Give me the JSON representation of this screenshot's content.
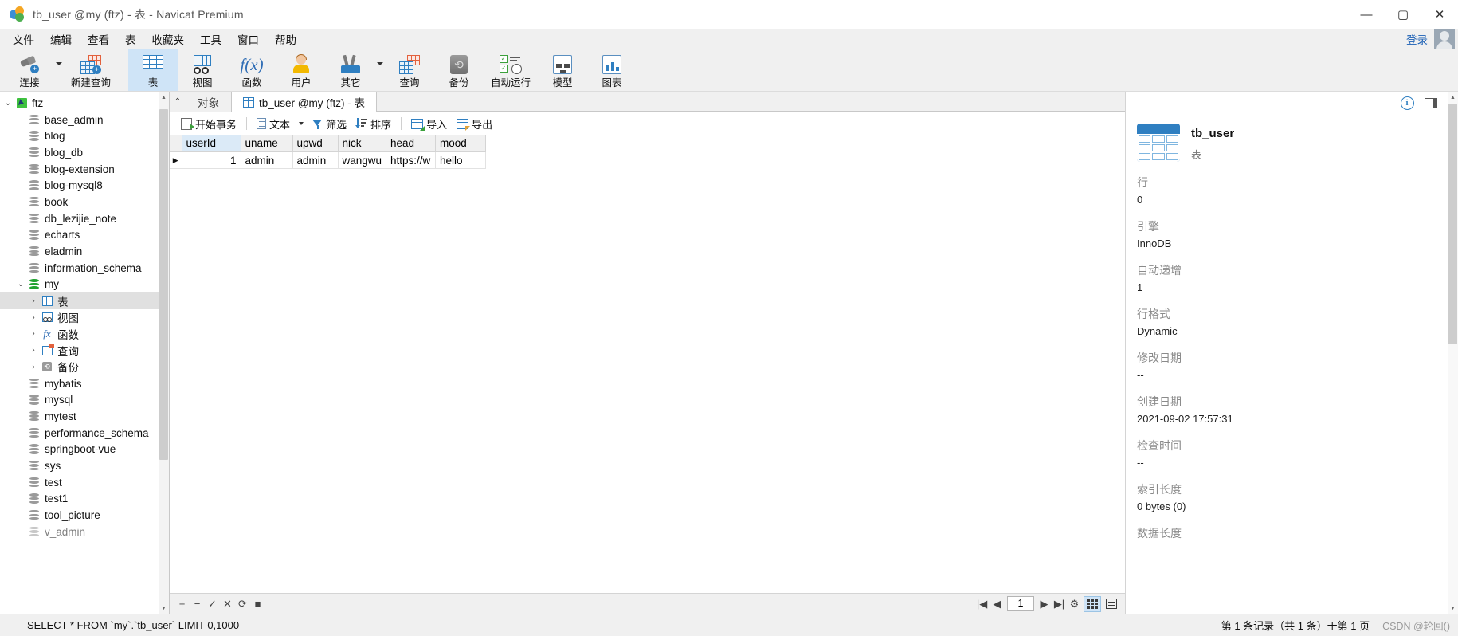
{
  "window": {
    "title": "tb_user @my (ftz) - 表 - Navicat Premium",
    "logo": "navicat-logo",
    "minimize": "—",
    "maximize": "▢",
    "close": "✕"
  },
  "menubar": {
    "items": [
      "文件",
      "编辑",
      "查看",
      "表",
      "收藏夹",
      "工具",
      "窗口",
      "帮助"
    ],
    "login_label": "登录"
  },
  "ribbon": {
    "items": [
      {
        "label": "连接",
        "icon": "connection-icon",
        "has_caret": true,
        "selected": false
      },
      {
        "label": "新建查询",
        "icon": "new-query-icon",
        "has_caret": false,
        "selected": false
      },
      {
        "label": "表",
        "icon": "table-icon",
        "has_caret": false,
        "selected": true
      },
      {
        "label": "视图",
        "icon": "view-icon",
        "has_caret": false,
        "selected": false
      },
      {
        "label": "函数",
        "icon": "function-icon",
        "has_caret": false,
        "selected": false
      },
      {
        "label": "用户",
        "icon": "user-icon",
        "has_caret": false,
        "selected": false
      },
      {
        "label": "其它",
        "icon": "other-tools-icon",
        "has_caret": true,
        "selected": false
      },
      {
        "label": "查询",
        "icon": "query-icon",
        "has_caret": false,
        "selected": false
      },
      {
        "label": "备份",
        "icon": "backup-icon",
        "has_caret": false,
        "selected": false
      },
      {
        "label": "自动运行",
        "icon": "automation-icon",
        "has_caret": false,
        "selected": false
      },
      {
        "label": "模型",
        "icon": "model-icon",
        "has_caret": false,
        "selected": false
      },
      {
        "label": "图表",
        "icon": "chart-icon",
        "has_caret": false,
        "selected": false
      }
    ]
  },
  "sidebar": {
    "nodes": [
      {
        "label": "ftz",
        "icon": "connection-node-icon",
        "level": 0,
        "expanded": true,
        "selected": false
      },
      {
        "label": "base_admin",
        "icon": "database-icon",
        "level": 1,
        "selected": false
      },
      {
        "label": "blog",
        "icon": "database-icon",
        "level": 1,
        "selected": false
      },
      {
        "label": "blog_db",
        "icon": "database-icon",
        "level": 1,
        "selected": false
      },
      {
        "label": "blog-extension",
        "icon": "database-icon",
        "level": 1,
        "selected": false
      },
      {
        "label": "blog-mysql8",
        "icon": "database-icon",
        "level": 1,
        "selected": false
      },
      {
        "label": "book",
        "icon": "database-icon",
        "level": 1,
        "selected": false
      },
      {
        "label": "db_lezijie_note",
        "icon": "database-icon",
        "level": 1,
        "selected": false
      },
      {
        "label": "echarts",
        "icon": "database-icon",
        "level": 1,
        "selected": false
      },
      {
        "label": "eladmin",
        "icon": "database-icon",
        "level": 1,
        "selected": false
      },
      {
        "label": "information_schema",
        "icon": "database-icon",
        "level": 1,
        "selected": false
      },
      {
        "label": "my",
        "icon": "database-open-icon",
        "level": 1,
        "expanded": true,
        "selected": false
      },
      {
        "label": "表",
        "icon": "tables-folder-icon",
        "level": 2,
        "collapsed": true,
        "selected": true
      },
      {
        "label": "视图",
        "icon": "views-folder-icon",
        "level": 2,
        "collapsed": true,
        "selected": false
      },
      {
        "label": "函数",
        "icon": "functions-folder-icon",
        "level": 2,
        "collapsed": true,
        "selected": false
      },
      {
        "label": "查询",
        "icon": "queries-folder-icon",
        "level": 2,
        "collapsed": true,
        "selected": false
      },
      {
        "label": "备份",
        "icon": "backups-folder-icon",
        "level": 2,
        "collapsed": true,
        "selected": false
      },
      {
        "label": "mybatis",
        "icon": "database-icon",
        "level": 1,
        "selected": false
      },
      {
        "label": "mysql",
        "icon": "database-icon",
        "level": 1,
        "selected": false
      },
      {
        "label": "mytest",
        "icon": "database-icon",
        "level": 1,
        "selected": false
      },
      {
        "label": "performance_schema",
        "icon": "database-icon",
        "level": 1,
        "selected": false
      },
      {
        "label": "springboot-vue",
        "icon": "database-icon",
        "level": 1,
        "selected": false
      },
      {
        "label": "sys",
        "icon": "database-icon",
        "level": 1,
        "selected": false
      },
      {
        "label": "test",
        "icon": "database-icon",
        "level": 1,
        "selected": false
      },
      {
        "label": "test1",
        "icon": "database-icon",
        "level": 1,
        "selected": false
      },
      {
        "label": "tool_picture",
        "icon": "database-icon",
        "level": 1,
        "selected": false
      },
      {
        "label": "v_admin",
        "icon": "database-icon",
        "level": 1,
        "selected": false
      }
    ]
  },
  "tabs": {
    "collapse_icon": "chevron-up-icon",
    "items": [
      {
        "label": "对象",
        "active": false,
        "icon": null
      },
      {
        "label": "tb_user @my (ftz) - 表",
        "active": true,
        "icon": "table-tab-icon"
      }
    ]
  },
  "grid_toolbar": {
    "buttons": [
      {
        "label": "开始事务",
        "icon": "begin-transaction-icon",
        "caret": false
      },
      {
        "label": "文本",
        "icon": "text-icon",
        "caret": true
      },
      {
        "label": "筛选",
        "icon": "filter-icon",
        "caret": false
      },
      {
        "label": "排序",
        "icon": "sort-icon",
        "caret": false
      },
      {
        "label": "导入",
        "icon": "import-icon",
        "caret": false
      },
      {
        "label": "导出",
        "icon": "export-icon",
        "caret": false
      }
    ]
  },
  "datagrid": {
    "columns": [
      "userId",
      "uname",
      "upwd",
      "nick",
      "head",
      "mood"
    ],
    "key_column": "userId",
    "rows": [
      {
        "current": true,
        "cells": [
          "1",
          "admin",
          "admin",
          "wangwu",
          "https://w",
          "hello"
        ]
      }
    ]
  },
  "grid_footer": {
    "add_label": "+",
    "remove_label": "−",
    "confirm_label": "✓",
    "cancel_label": "✕",
    "refresh_label": "⟳",
    "stop_label": "■",
    "first_label": "|◀",
    "prev_label": "◀",
    "page_value": "1",
    "next_label": "▶",
    "last_label": "▶|",
    "settings_label": "gear-icon",
    "grid_view_label": "grid-view-icon",
    "form_view_label": "form-view-icon"
  },
  "info_panel": {
    "header_icons": [
      "info-icon",
      "toggle-panel-icon"
    ],
    "object_icon": "table-large-icon",
    "object_name": "tb_user",
    "object_type": "表",
    "fields": [
      {
        "label": "行",
        "value": "0"
      },
      {
        "label": "引擎",
        "value": "InnoDB"
      },
      {
        "label": "自动递增",
        "value": "1"
      },
      {
        "label": "行格式",
        "value": "Dynamic"
      },
      {
        "label": "修改日期",
        "value": "--"
      },
      {
        "label": "创建日期",
        "value": "2021-09-02 17:57:31"
      },
      {
        "label": "检查时间",
        "value": "--"
      },
      {
        "label": "索引长度",
        "value": "0 bytes (0)"
      },
      {
        "label": "数据长度",
        "value": ""
      }
    ]
  },
  "statusbar": {
    "sql": "SELECT * FROM `my`.`tb_user` LIMIT 0,1000",
    "record_info": "第 1 条记录（共 1 条）于第 1 页",
    "watermark": "CSDN @轮回()"
  }
}
